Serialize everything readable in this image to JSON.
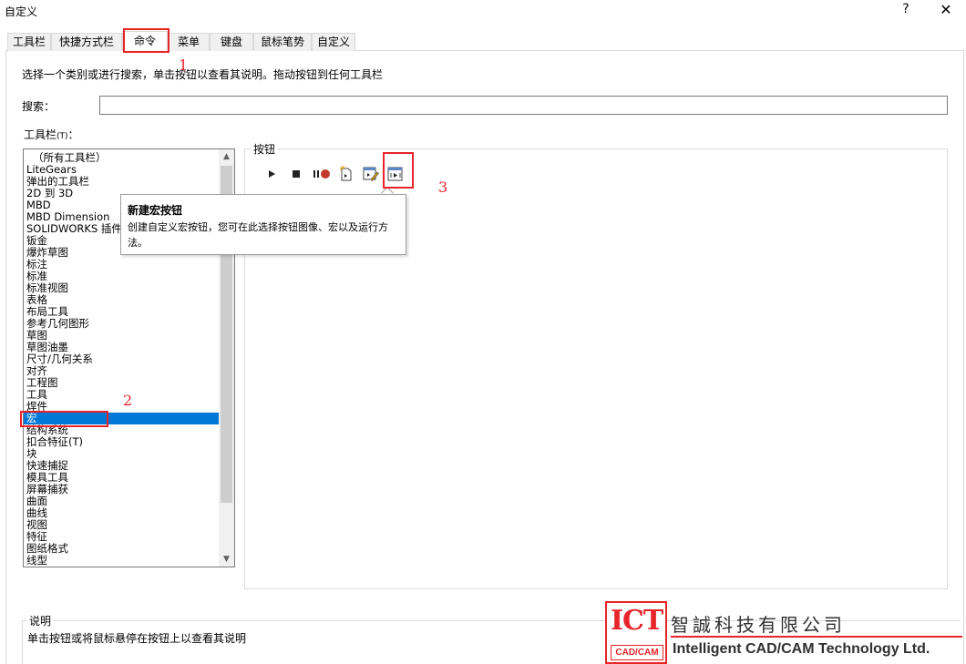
{
  "window": {
    "title": "自定义",
    "help_glyph": "?",
    "close_glyph": "✕"
  },
  "tabs": [
    {
      "label": "工具栏"
    },
    {
      "label": "快捷方式栏"
    },
    {
      "label": "命令"
    },
    {
      "label": "菜单"
    },
    {
      "label": "键盘"
    },
    {
      "label": "鼠标笔势"
    },
    {
      "label": "自定义"
    }
  ],
  "intro_text": "选择一个类别或进行搜索，单击按钮以查看其说明。拖动按钮到任何工具栏",
  "search": {
    "label": "搜索：",
    "value": ""
  },
  "toolbars": {
    "label": "工具栏",
    "accel": "(T)",
    "colon": "：",
    "selected": "宏",
    "items": [
      "（所有工具栏）",
      "LiteGears",
      "弹出的工具栏",
      "2D 到 3D",
      "MBD",
      "MBD Dimension",
      "SOLIDWORKS 插件",
      "钣金",
      "爆炸草图",
      "标注",
      "标准",
      "标准视图",
      "表格",
      "布局工具",
      "参考几何图形",
      "草图",
      "草图油墨",
      "尺寸/几何关系",
      "对齐",
      "工程图",
      "工具",
      "焊件",
      "宏",
      "结构系统",
      "扣合特征(T)",
      "块",
      "快速捕捉",
      "模具工具",
      "屏幕捕获",
      "曲面",
      "曲线",
      "视图",
      "特征",
      "图纸格式",
      "线型"
    ]
  },
  "buttons_panel": {
    "label": "按钮",
    "commands": [
      {
        "icon": "run-macro-icon"
      },
      {
        "icon": "stop-macro-icon"
      },
      {
        "icon": "record-pause-macro-icon"
      },
      {
        "icon": "new-macro-icon"
      },
      {
        "icon": "edit-macro-icon"
      },
      {
        "icon": "new-macro-button-icon"
      }
    ]
  },
  "tooltip": {
    "title": "新建宏按钮",
    "body": "创建自定义宏按钮，您可在此选择按钮图像、宏以及运行方法。"
  },
  "annotations": {
    "n1": "1",
    "n2": "2",
    "n3": "3",
    "color": "#e8242a"
  },
  "description": {
    "label": "说明",
    "text": "单击按钮或将鼠标悬停在按钮上以查看其说明"
  },
  "watermark": {
    "logo_text": "ICT",
    "logo_sub": "CAD/CAM",
    "company_cn": "智誠科技有限公司",
    "company_en": "Intelligent CAD/CAM Technology Ltd."
  },
  "colors": {
    "selection": "#0078d7",
    "accent_red": "#e8242a"
  }
}
